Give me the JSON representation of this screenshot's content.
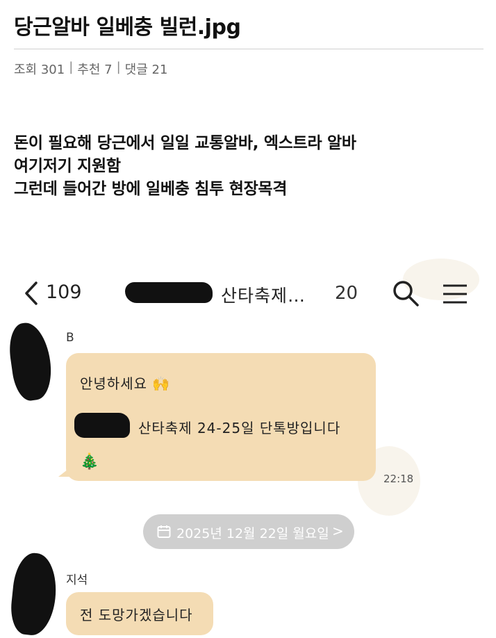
{
  "post": {
    "title": "당근알바 일베충 빌런.jpg",
    "views": "조회 301",
    "recommends": "추천 7",
    "comments": "댓글 21",
    "separator": "|",
    "body_lines": [
      "돈이 필요해 당근에서 일일 교통알바, 엑스트라 알바",
      "여기저기 지원함",
      "그런데 들어간 방에 일베충 침투 현장목격"
    ]
  },
  "chat": {
    "back_count": "109",
    "room_name": "산타축제…",
    "member_count": "20",
    "messages": [
      {
        "sender": "B",
        "lines": [
          "안녕하세요 🙌",
          "산타축제 24-25일 단톡방입니다",
          "🎄"
        ],
        "time": "22:18"
      },
      {
        "sender": "지석",
        "lines": [
          "전 도망가겠습니다"
        ]
      }
    ],
    "date_divider": "2025년 12월 22일 월요일",
    "date_chevron": ">"
  },
  "colors": {
    "bubble": "#f4dcb4",
    "pill": "#cfcfcf",
    "redaction": "#111111"
  },
  "icons": {
    "back": "chevron-left-icon",
    "search": "search-icon",
    "menu": "hamburger-menu-icon",
    "calendar": "calendar-icon"
  }
}
